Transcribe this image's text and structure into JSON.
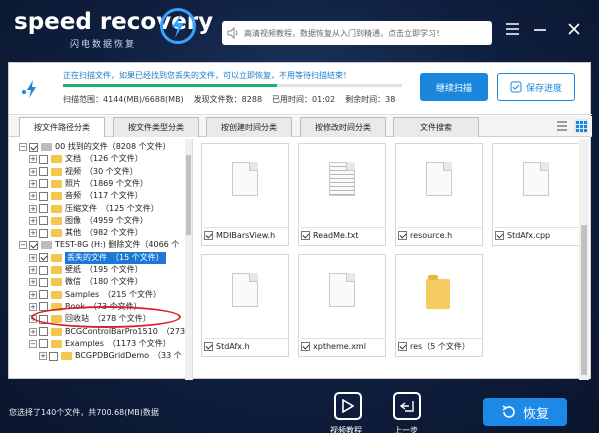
{
  "app": {
    "name": "speed recovery",
    "subtitle": "闪电数据恢复"
  },
  "search": {
    "placeholder": "高清视频教程，数据恢复从入门到精通，点击立即学习！"
  },
  "window": {
    "menu_icon": "menu-icon",
    "minimize_icon": "minimize-icon",
    "close_icon": "close-icon"
  },
  "status": {
    "message": "正在扫描文件，如果已经找到您丢失的文件，可以立即恢复，不用等待扫描结束！",
    "progress": 0.63,
    "scan_range": "扫描范围：4144(MB)/6688(MB)",
    "found_files": "发现文件数：8288",
    "elapsed": "已用时间：01:02",
    "remaining": "剩余时间：38",
    "continue_scan_label": "继续扫描",
    "save_progress_label": "保存进度"
  },
  "tabs": [
    {
      "label": "按文件路径分类",
      "active": true
    },
    {
      "label": "按文件类型分类",
      "active": false
    },
    {
      "label": "按创建时间分类",
      "active": false
    },
    {
      "label": "按修改时间分类",
      "active": false
    },
    {
      "label": "文件搜索",
      "active": false
    }
  ],
  "tree": [
    {
      "label": "00 找到的文件（8208 个文件）",
      "level": 0,
      "expander": "⊟",
      "checked": true,
      "folder": "lg"
    },
    {
      "label": "文档　（126 个文件）",
      "level": 1,
      "expander": "⊞",
      "checked": false
    },
    {
      "label": "视频　（30 个文件）",
      "level": 1,
      "expander": "⊞",
      "checked": false
    },
    {
      "label": "照片　（1869 个文件）",
      "level": 1,
      "expander": "⊞",
      "checked": false
    },
    {
      "label": "音频　（117 个文件）",
      "level": 1,
      "expander": "⊞",
      "checked": false
    },
    {
      "label": "压缩文件　（125 个文件）",
      "level": 1,
      "expander": "⊞",
      "checked": false
    },
    {
      "label": "图像　（4959 个文件）",
      "level": 1,
      "expander": "⊞",
      "checked": false
    },
    {
      "label": "其他　（982 个文件）",
      "level": 1,
      "expander": "⊞",
      "checked": false
    },
    {
      "label": "TEST-8G (H:) 删除文件（4066 个",
      "level": 0,
      "expander": "⊟",
      "checked": true,
      "folder": "lg"
    },
    {
      "label": "丢失的文件　（15 个文件）",
      "level": 1,
      "expander": "⊞",
      "checked": true,
      "selected": true
    },
    {
      "label": "壁纸　（195 个文件）",
      "level": 1,
      "expander": "⊞",
      "checked": false
    },
    {
      "label": "微信　（180 个文件）",
      "level": 1,
      "expander": "⊞",
      "checked": false
    },
    {
      "label": "Samples　（215 个文件）",
      "level": 1,
      "expander": "⊞",
      "checked": false
    },
    {
      "label": "Book　（73 个文件）",
      "level": 1,
      "expander": "⊞",
      "checked": false
    },
    {
      "label": "回收站　（278 个文件）",
      "level": 1,
      "expander": "⊞",
      "checked": false
    },
    {
      "label": "BCGControlBarPro1510　（273",
      "level": 1,
      "expander": "⊞",
      "checked": false
    },
    {
      "label": "Examples　（1173 个文件）",
      "level": 1,
      "expander": "⊟",
      "checked": false
    },
    {
      "label": "BCGPDBGridDemo　（33 个",
      "level": 2,
      "expander": "⊞",
      "checked": false
    }
  ],
  "files": [
    {
      "name": "MDIBarsView.h",
      "icon": "document-icon",
      "checked": true
    },
    {
      "name": "ReadMe.txt",
      "icon": "text-file-icon",
      "checked": true
    },
    {
      "name": "resource.h",
      "icon": "document-icon",
      "checked": true
    },
    {
      "name": "StdAfx.cpp",
      "icon": "document-icon",
      "checked": true
    },
    {
      "name": "StdAfx.h",
      "icon": "document-icon",
      "checked": true
    },
    {
      "name": "xptheme.xml",
      "icon": "document-icon",
      "checked": true
    },
    {
      "name": "res（5 个文件）",
      "icon": "folder-icon",
      "checked": true
    }
  ],
  "footer": {
    "selection_info": "您选择了140个文件，共700.68(MB)数据",
    "video_tutorial_label": "视频教程",
    "back_label": "上一步",
    "recover_label": "恢复"
  },
  "colors": {
    "accent": "#1a87dd",
    "progress": "#19b16e",
    "highlight_ring": "#d6202a"
  }
}
